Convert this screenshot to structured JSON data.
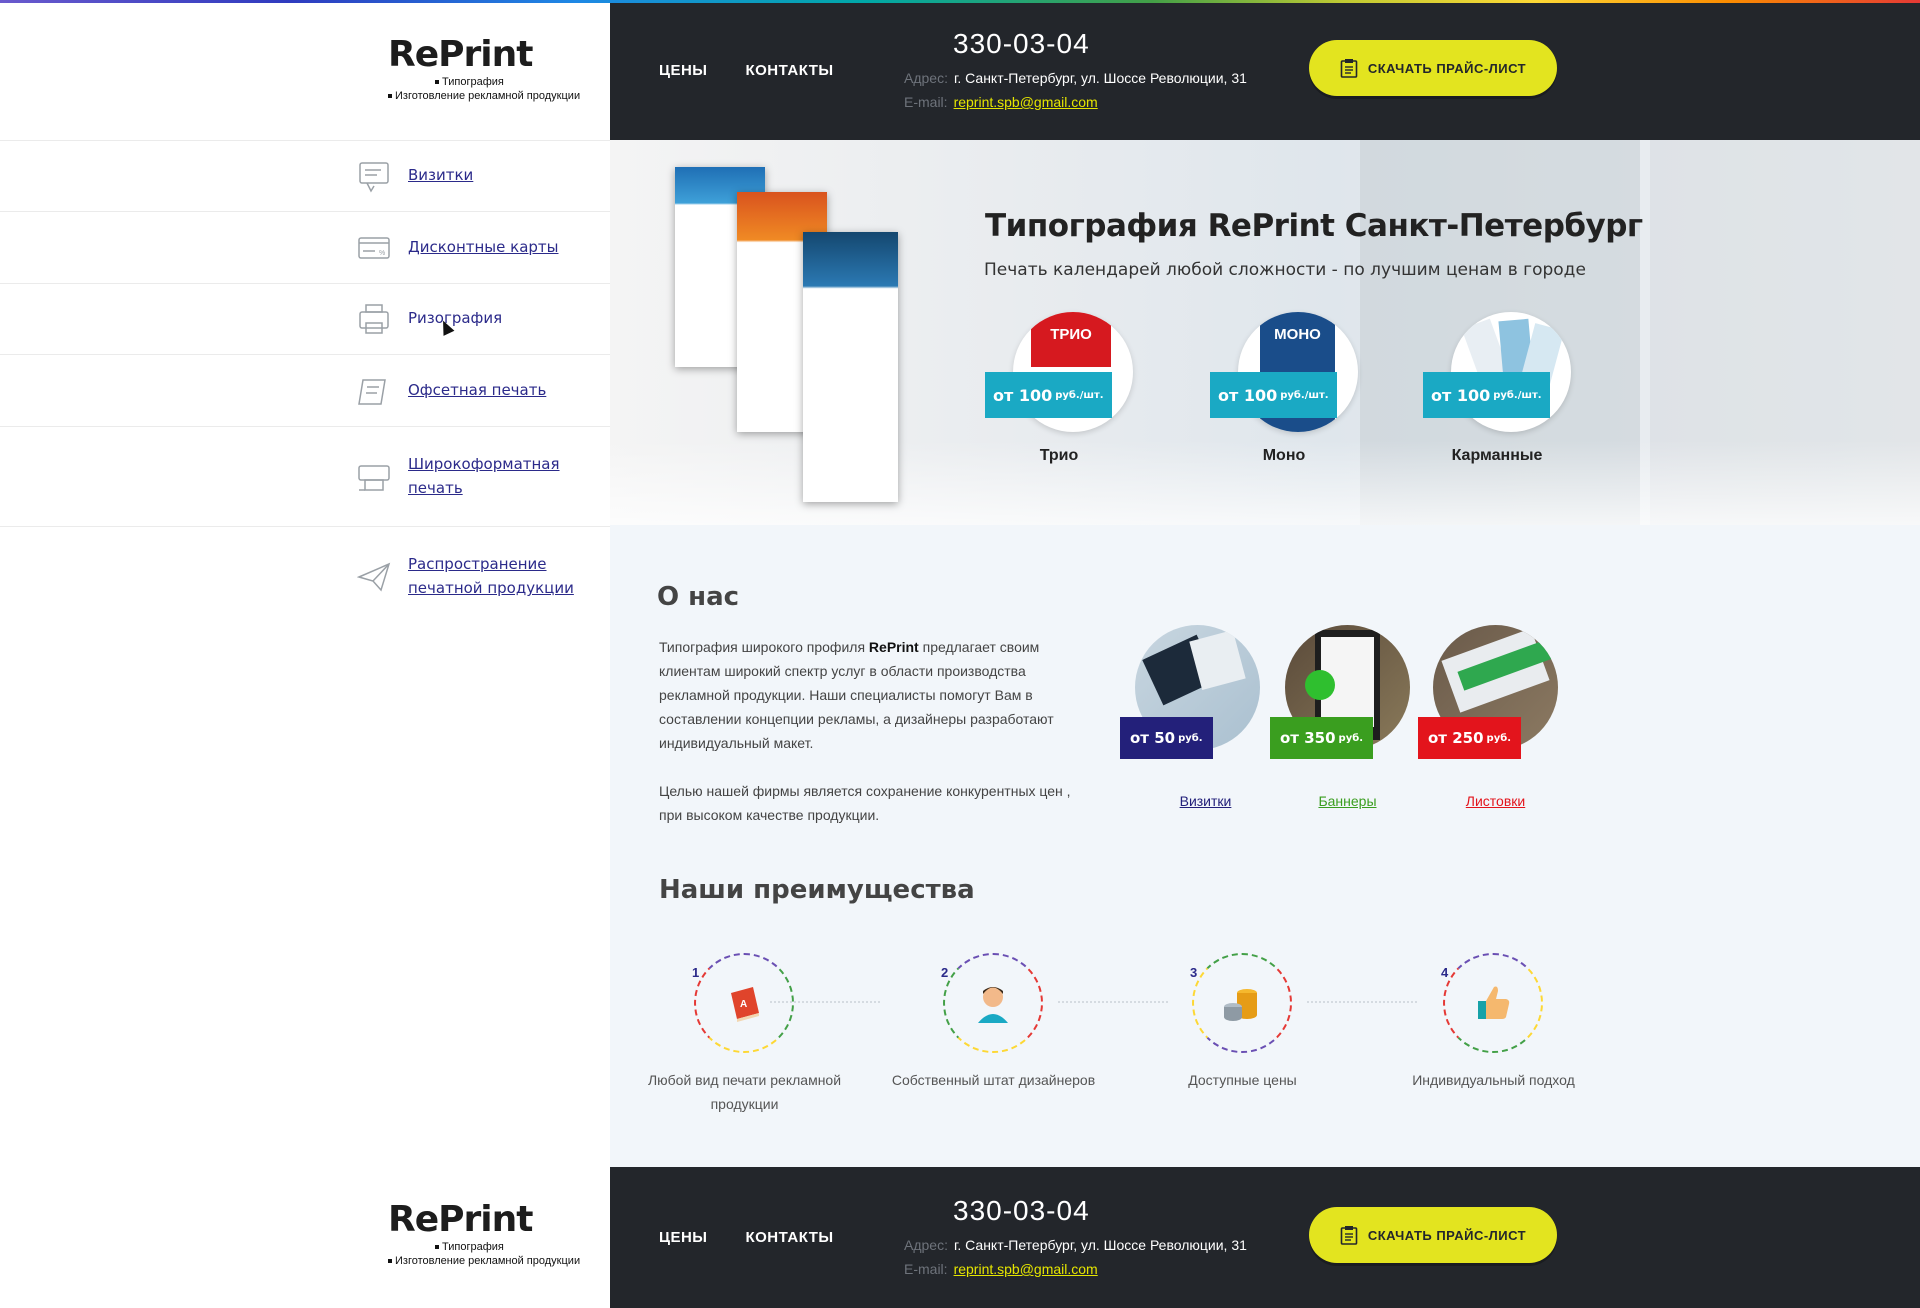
{
  "brand": {
    "logo_text": "RePrint",
    "tagline_1": "Типография",
    "tagline_2": "Изготовление рекламной продукции"
  },
  "header": {
    "links": [
      "ЦЕНЫ",
      "КОНТАКТЫ"
    ],
    "phone": "330-03-04",
    "address_label": "Адрес:",
    "address_value": "г. Санкт-Петербург, ул. Шоссе Революции, 31",
    "email_label": "E-mail:",
    "email_value": "reprint.spb@gmail.com",
    "price_button": "СКАЧАТЬ ПРАЙС-ЛИСТ"
  },
  "sidebar": {
    "items": [
      {
        "label": "Визитки",
        "icon": "business-card-icon"
      },
      {
        "label": "Дисконтные карты",
        "icon": "discount-card-icon"
      },
      {
        "label": "Ризография",
        "icon": "printer-icon"
      },
      {
        "label": "Офсетная печать",
        "icon": "offset-print-icon"
      },
      {
        "label": "Широкоформатная печать",
        "icon": "wide-format-printer-icon"
      },
      {
        "label": "Распространение печатной продукции",
        "icon": "paper-plane-icon"
      }
    ]
  },
  "hero": {
    "title": "Типография RePrint Санкт-Петербург",
    "subtitle": "Печать календарей любой сложности - по лучшим ценам в городе",
    "products": [
      {
        "name": "Трио",
        "price": "от 100",
        "unit": "руб./шт.",
        "badge": "ТРИО"
      },
      {
        "name": "Моно",
        "price": "от 100",
        "unit": "руб./шт.",
        "badge": "МОНО"
      },
      {
        "name": "Карманные",
        "price": "от 100",
        "unit": "руб./шт."
      }
    ]
  },
  "about": {
    "title": "О нас",
    "p1_before": "Типография широкого профиля ",
    "p1_brand": "RePrint",
    "p1_after": " предлагает своим клиентам широкий спектр услуг в области производства рекламной продукции. Наши специалисты помогут Вам в составлении концепции рекламы, а дизайнеры разработают индивидуальный макет.",
    "p2": "Целью нашей фирмы является сохранение конкурентных цен , при высоком качестве продукции.",
    "services": [
      {
        "label": "Визитки",
        "price": "от 50",
        "unit": "руб.",
        "color": "#23207a"
      },
      {
        "label": "Баннеры",
        "price": "от 350",
        "unit": "руб.",
        "color": "#3a9e1f"
      },
      {
        "label": "Листовки",
        "price": "от 250",
        "unit": "руб.",
        "color": "#e3141c"
      }
    ]
  },
  "advantages": {
    "title": "Наши преимущества",
    "items": [
      {
        "num": "1",
        "text": "Любой вид печати рекламной продукции",
        "icon": "book-icon"
      },
      {
        "num": "2",
        "text": "Собственный штат дизайнеров",
        "icon": "designer-person-icon"
      },
      {
        "num": "3",
        "text": "Доступные цены",
        "icon": "coins-icon"
      },
      {
        "num": "4",
        "text": "Индивидуальный подход",
        "icon": "thumbs-up-icon"
      }
    ]
  },
  "colors": {
    "dark": "#23262b",
    "accent_yellow": "#e3e41f",
    "nav_link": "#2b2a8a",
    "price_tag": "#1aa9c4"
  }
}
